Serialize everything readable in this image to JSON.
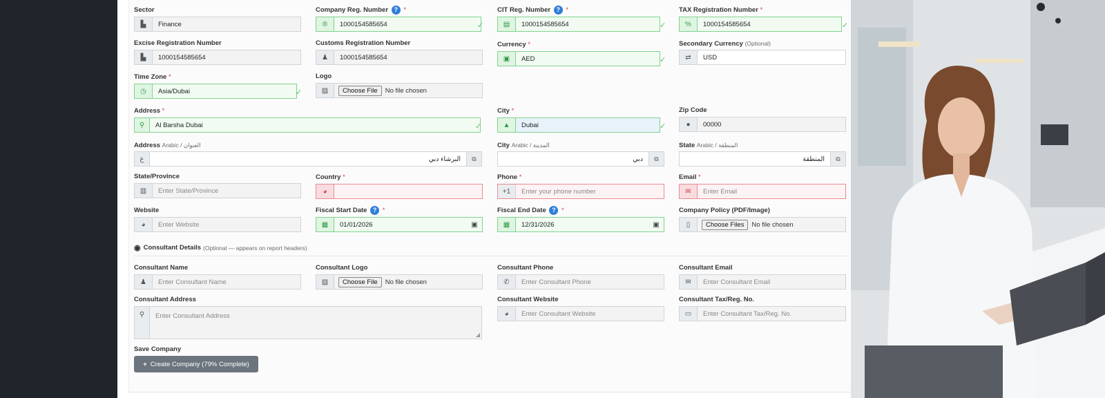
{
  "form": {
    "sector": {
      "label": "Sector",
      "value": "Finance"
    },
    "company_reg": {
      "label": "Company Reg. Number",
      "value": "1000154585654"
    },
    "cit_reg": {
      "label": "CIT Reg. Number",
      "value": "1000154585654"
    },
    "tax_reg": {
      "label": "TAX Registration Number",
      "value": "1000154585654"
    },
    "excise_reg": {
      "label": "Excise Registration Number",
      "value": "1000154585654"
    },
    "customs_reg": {
      "label": "Customs Registration Number",
      "value": "1000154585654"
    },
    "currency": {
      "label": "Currency",
      "value": "AED"
    },
    "secondary_currency": {
      "label": "Secondary Currency",
      "optional": "(Optional)",
      "value": "USD"
    },
    "time_zone": {
      "label": "Time Zone",
      "value": "Asia/Dubai"
    },
    "logo": {
      "label": "Logo",
      "button": "Choose File",
      "status": "No file chosen"
    },
    "address": {
      "label": "Address",
      "value": "Al Barsha Dubai"
    },
    "city": {
      "label": "City",
      "value": "Dubai"
    },
    "zip": {
      "label": "Zip Code",
      "value": "00000"
    },
    "address_ar": {
      "label": "Address",
      "sub": "Arabic / العنوان",
      "value": "البرشاء دبي"
    },
    "city_ar": {
      "label": "City",
      "sub": "Arabic / المدينة",
      "value": "دبي"
    },
    "state_ar": {
      "label": "State",
      "sub": "Arabic / المنطقة",
      "value": "المنطقة"
    },
    "state_province": {
      "label": "State/Province",
      "placeholder": "Enter State/Province"
    },
    "country": {
      "label": "Country",
      "value": ""
    },
    "phone": {
      "label": "Phone",
      "prefix": "+1",
      "placeholder": "Enter your phone number"
    },
    "email": {
      "label": "Email",
      "placeholder": "Enter Email"
    },
    "website": {
      "label": "Website",
      "placeholder": "Enter Website"
    },
    "fiscal_start": {
      "label": "Fiscal Start Date",
      "value": "01/01/2026"
    },
    "fiscal_end": {
      "label": "Fiscal End Date",
      "value": "12/31/2026"
    },
    "company_policy": {
      "label": "Company Policy (PDF/Image)",
      "button": "Choose Files",
      "status": "No file chosen"
    }
  },
  "consultant": {
    "section_title": "Consultant Details",
    "section_note": "(Optional — appears on report headers)",
    "name": {
      "label": "Consultant Name",
      "placeholder": "Enter Consultant Name"
    },
    "logo": {
      "label": "Consultant Logo",
      "button": "Choose File",
      "status": "No file chosen"
    },
    "phone": {
      "label": "Consultant Phone",
      "placeholder": "Enter Consultant Phone"
    },
    "email": {
      "label": "Consultant Email",
      "placeholder": "Enter Consultant Email"
    },
    "address": {
      "label": "Consultant Address",
      "placeholder": "Enter Consultant Address"
    },
    "website": {
      "label": "Consultant Website",
      "placeholder": "Enter Consultant Website"
    },
    "tax": {
      "label": "Consultant Tax/Reg. No.",
      "placeholder": "Enter Consultant Tax/Reg. No."
    }
  },
  "save": {
    "label": "Save Company",
    "button": "Create Company (79% Complete)",
    "completion_percent": 79
  },
  "colors": {
    "valid": "#7fd38c",
    "invalid": "#ea8a92",
    "button": "#6c757d",
    "help": "#2f7fd8"
  }
}
